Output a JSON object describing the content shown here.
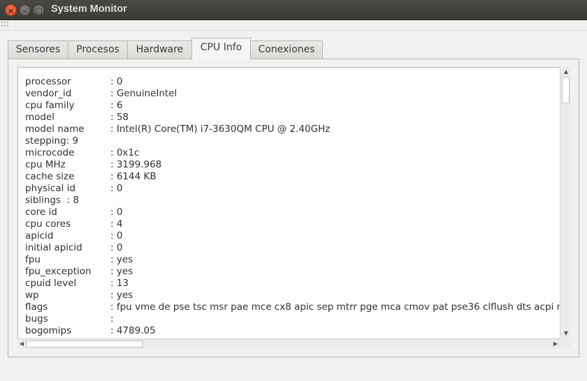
{
  "window": {
    "title": "System Monitor",
    "close_glyph": "×",
    "minimize_glyph": "–",
    "maximize_glyph": "□"
  },
  "tabs": [
    {
      "label": "Sensores"
    },
    {
      "label": "Procesos"
    },
    {
      "label": "Hardware"
    },
    {
      "label": "CPU Info",
      "active": true
    },
    {
      "label": "Conexiones"
    }
  ],
  "cpu_info": [
    {
      "key": "processor",
      "value": ": 0"
    },
    {
      "key": "vendor_id",
      "value": ": GenuineIntel"
    },
    {
      "key": "cpu family",
      "value": ": 6"
    },
    {
      "key": "model",
      "value": ": 58"
    },
    {
      "key": "model name",
      "value": ": Intel(R) Core(TM) i7-3630QM CPU @ 2.40GHz"
    },
    {
      "key": "stepping",
      "value": ": 9",
      "inline": true
    },
    {
      "key": "microcode",
      "value": ": 0x1c"
    },
    {
      "key": "cpu MHz",
      "value": ": 3199.968"
    },
    {
      "key": "cache size",
      "value": ": 6144 KB"
    },
    {
      "key": "physical id",
      "value": ": 0"
    },
    {
      "key": "siblings",
      "value": ": 8",
      "inline": true
    },
    {
      "key": "core id",
      "value": ": 0"
    },
    {
      "key": "cpu cores",
      "value": ": 4"
    },
    {
      "key": "apicid",
      "value": ": 0"
    },
    {
      "key": "initial apicid",
      "value": ": 0"
    },
    {
      "key": "fpu",
      "value": ": yes"
    },
    {
      "key": "fpu_exception",
      "value": ": yes"
    },
    {
      "key": "cpuid level",
      "value": ": 13"
    },
    {
      "key": "wp",
      "value": ": yes"
    },
    {
      "key": "flags",
      "value": ": fpu vme de pse tsc msr pae mce cx8 apic sep mtrr pge mca cmov pat pse36 clflush dts acpi mm"
    },
    {
      "key": "bugs",
      "value": ":"
    },
    {
      "key": "bogomips",
      "value": ": 4789.05"
    }
  ],
  "scrollbars": {
    "up_glyph": "▲",
    "down_glyph": "▼",
    "left_glyph": "◀",
    "right_glyph": "▶"
  },
  "colors": {
    "titlebar": "#3c3b37",
    "close_button": "#e95420",
    "window_bg": "#f2f1f0"
  }
}
